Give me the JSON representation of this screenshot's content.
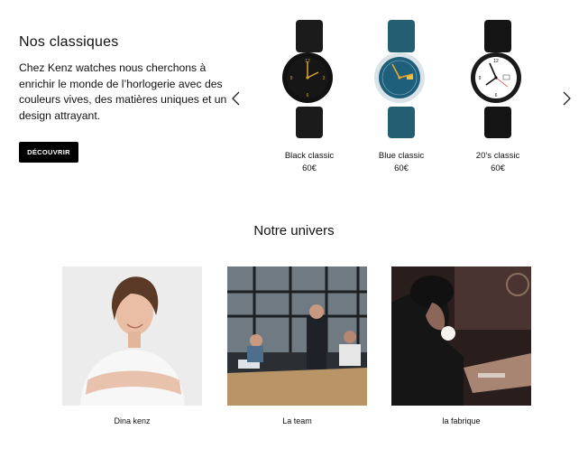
{
  "hero": {
    "title": "Nos classiques",
    "description": "Chez Kenz watches nous cherchons à enrichir le monde de l’horlogerie avec des couleurs vives, des matières uniques et un design attrayant.",
    "button_label": "DÉCOUVRIR"
  },
  "carousel": {
    "prev_icon": "chevron-left-icon",
    "next_icon": "chevron-right-icon",
    "products": [
      {
        "name": "Black classic",
        "price": "60€",
        "strap_color": "#1b1b1b",
        "dial_color": "#151515",
        "hands_color": "#d9a32a"
      },
      {
        "name": "Blue classic",
        "price": "60€",
        "strap_color": "#245e73",
        "dial_color": "#1e5f7c",
        "hands_color": "#f0a526"
      },
      {
        "name": "20’s classic",
        "price": "60€",
        "strap_color": "#141414",
        "dial_color": "#ffffff",
        "hands_color": "#111111"
      }
    ]
  },
  "universe": {
    "title": "Notre univers",
    "cards": [
      {
        "caption": "Dina kenz"
      },
      {
        "caption": "La team"
      },
      {
        "caption": "la fabrique"
      }
    ]
  }
}
